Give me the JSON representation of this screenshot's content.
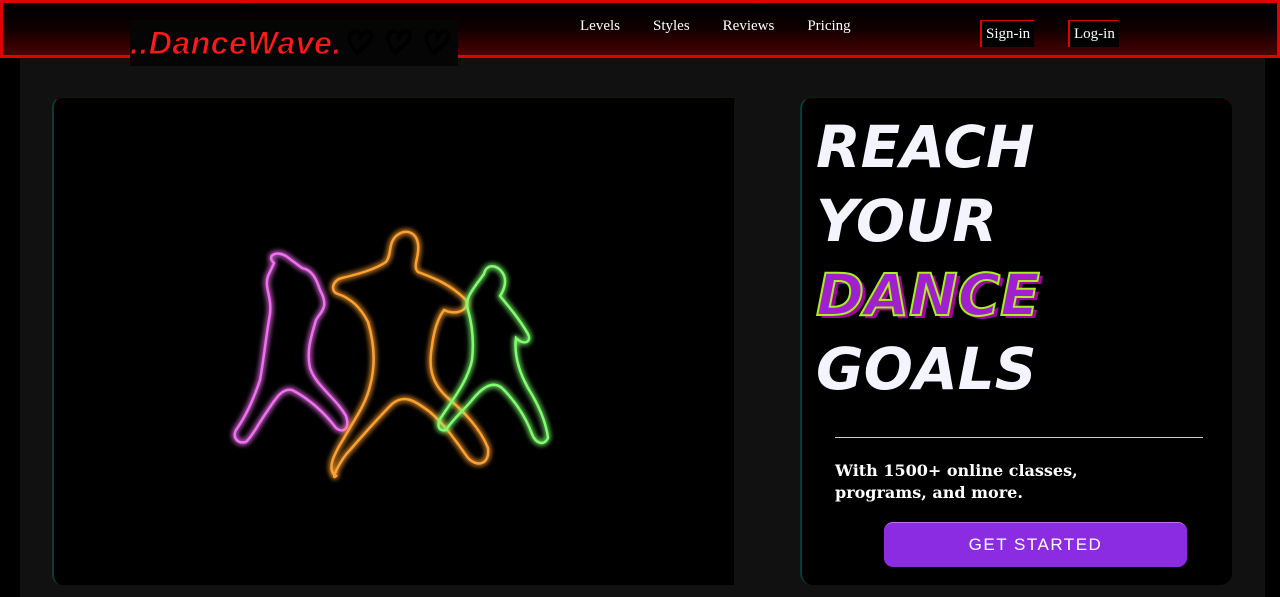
{
  "brand": {
    "logo_text": "..DanceWave.♡ ♡ ♡"
  },
  "nav": {
    "items": [
      {
        "label": "Levels"
      },
      {
        "label": "Styles"
      },
      {
        "label": "Reviews"
      },
      {
        "label": "Pricing"
      }
    ],
    "signin_label": "Sign-in",
    "login_label": "Log-in"
  },
  "hero": {
    "headline_line1": "REACH",
    "headline_line2": "YOUR",
    "headline_accent": "DANCE",
    "headline_line4": "GOALS",
    "subtext": "With 1500+ online classes, programs, and more.",
    "cta_label": "GET STARTED"
  },
  "colors": {
    "brand_red": "#e00000",
    "cta_purple": "#8b2be2",
    "accent_green": "#a8f020",
    "neon_pink": "#e040e0",
    "neon_orange": "#ff9a20",
    "neon_green": "#70ff60"
  }
}
